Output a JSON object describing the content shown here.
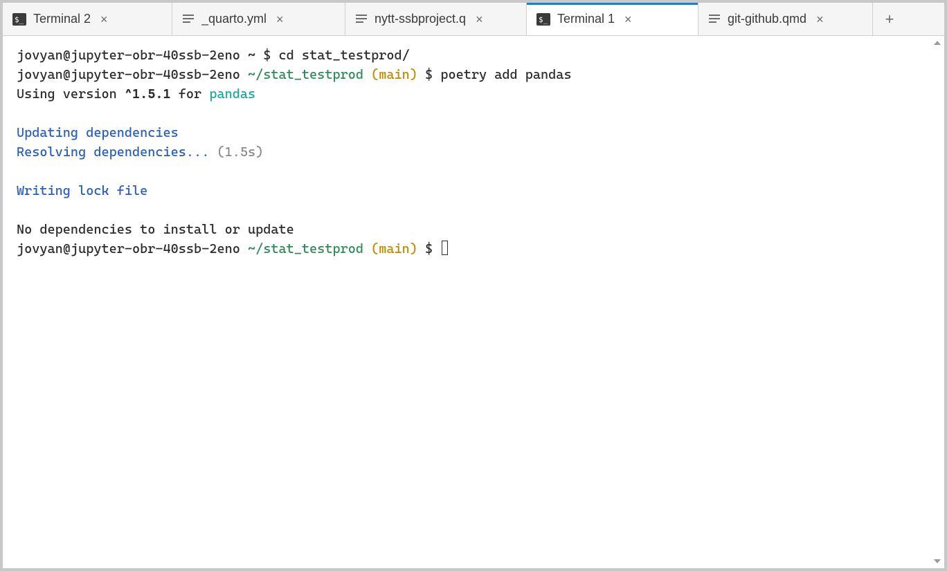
{
  "tabs": [
    {
      "label": "Terminal 2",
      "icon": "terminal-icon",
      "active": false
    },
    {
      "label": "_quarto.yml",
      "icon": "file-lines-icon",
      "active": false
    },
    {
      "label": "nytt-ssbproject.q",
      "icon": "file-lines-icon",
      "active": false
    },
    {
      "label": "Terminal 1",
      "icon": "terminal-icon",
      "active": true
    },
    {
      "label": "git-github.qmd",
      "icon": "file-lines-icon",
      "active": false
    }
  ],
  "close_glyph": "×",
  "new_tab_glyph": "+",
  "terminal": {
    "line1": {
      "user_host": "jovyan@jupyter-obr-40ssb-2eno",
      "tilde": " ~ ",
      "prompt": "$ ",
      "cmd": "cd stat_testprod/"
    },
    "line2": {
      "user_host": "jovyan@jupyter-obr-40ssb-2eno ",
      "path": "~/stat_testprod ",
      "branch": "(main)",
      "prompt": " $ ",
      "cmd": "poetry add pandas"
    },
    "line3": {
      "a": "Using version ",
      "b": "^1.5.1",
      "c": " for ",
      "d": "pandas"
    },
    "blank1": "",
    "line4": "Updating dependencies",
    "line5a": "Resolving dependencies...",
    "line5b": " (1.5s)",
    "blank2": "",
    "line6": "Writing lock file",
    "blank3": "",
    "line7": "No dependencies to install or update",
    "line8": {
      "user_host": "jovyan@jupyter-obr-40ssb-2eno ",
      "path": "~/stat_testprod ",
      "branch": "(main)",
      "prompt": " $ "
    }
  }
}
